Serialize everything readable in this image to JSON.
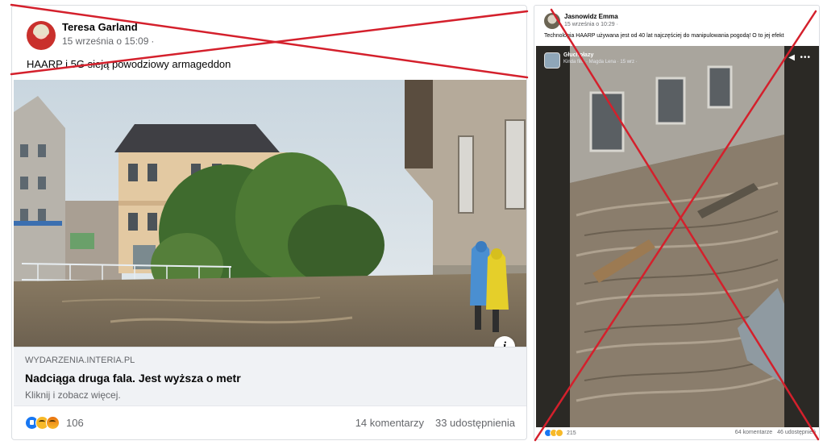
{
  "left_post": {
    "author": "Teresa Garland",
    "timestamp": "15 września o 15:09",
    "meta_separator": "·",
    "privacy_icon": "globe-icon",
    "text": "HAARP i 5G sieją powodziowy armageddon",
    "link": {
      "domain": "WYDARZENIA.INTERIA.PL",
      "title": "Nadciąga druga fala. Jest wyższa o metr",
      "subtitle": "Kliknij i zobacz więcej."
    },
    "info_button": "i",
    "reactions": [
      "like",
      "haha",
      "angry"
    ],
    "reaction_count": "106",
    "comments": "14 komentarzy",
    "shares": "33 udostępnienia"
  },
  "right_post": {
    "author": "Jasnowidz Emma",
    "timestamp": "15 września o 10:29 ·",
    "text": "Technologia HAARP używana jest od 40 lat najczęściej do manipulowania pogodą! O to jej efekt",
    "video": {
      "page_name": "Głuchołazy",
      "page_meta": "Kinda film · Magda Lena · 15 wrz · ",
      "volume_icon": "speaker-icon",
      "more_icon": "more-dots-icon"
    },
    "reactions": [
      "like",
      "haha",
      "wow"
    ],
    "reaction_count": "215",
    "comments": "64 komentarze",
    "shares": "46 udostępnień"
  },
  "colors": {
    "cross_red": "#d4202c",
    "facebook_blue": "#1877f2",
    "muted_text": "#65676b"
  }
}
